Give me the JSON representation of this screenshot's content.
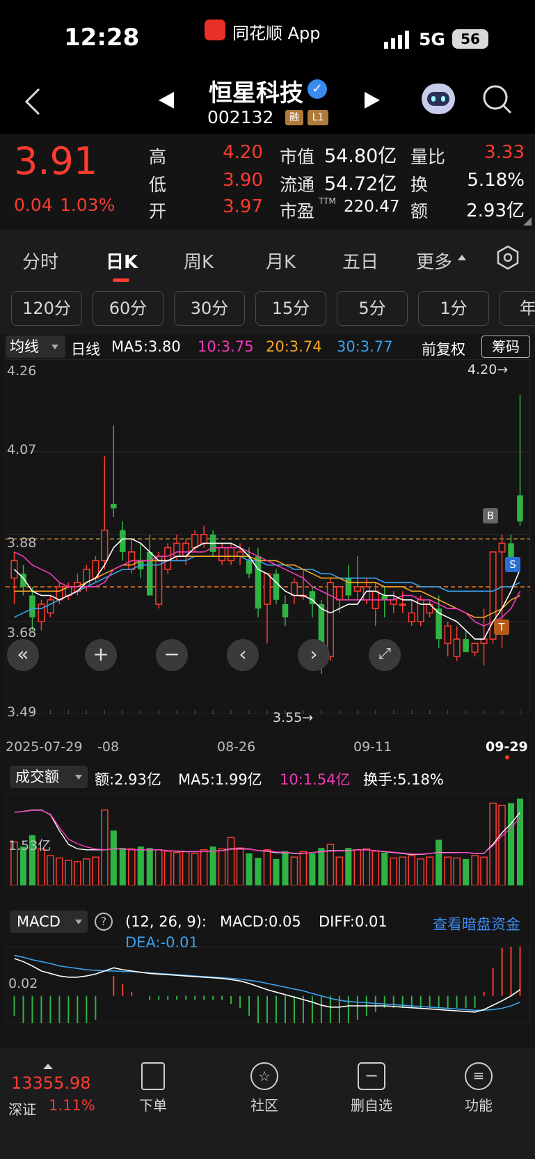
{
  "status_bar": {
    "time": "12:28",
    "app_label": "同花顺 App",
    "network": "5G",
    "battery": "56"
  },
  "header": {
    "stock_name": "恒星科技",
    "stock_code": "002132",
    "badge_margin": "融",
    "badge_level": "L1"
  },
  "quote": {
    "price": "3.91",
    "change": "0.04",
    "change_pct": "1.03%",
    "high_label": "高",
    "high": "4.20",
    "low_label": "低",
    "low": "3.90",
    "open_label": "开",
    "open": "3.97",
    "mcap_label": "市值",
    "mcap": "54.80亿",
    "float_label": "流通",
    "float": "54.72亿",
    "pe_label": "市盈",
    "pe_sup": "TTM",
    "pe": "220.47",
    "vr_label": "量比",
    "vr": "3.33",
    "turnover_label": "换",
    "turnover": "5.18%",
    "amount_label": "额",
    "amount": "2.93亿"
  },
  "tabs": [
    {
      "label": "分时"
    },
    {
      "label": "日K"
    },
    {
      "label": "周K"
    },
    {
      "label": "月K"
    },
    {
      "label": "五日"
    },
    {
      "label": "更多"
    }
  ],
  "periods": [
    {
      "label": "120分"
    },
    {
      "label": "60分"
    },
    {
      "label": "30分"
    },
    {
      "label": "15分"
    },
    {
      "label": "5分"
    },
    {
      "label": "1分"
    },
    {
      "label": "年"
    }
  ],
  "ma_bar": {
    "selector": "均线",
    "period": "日线",
    "ma5": "MA5:3.80",
    "ma10": "10:3.75",
    "ma20": "20:3.74",
    "ma30": "30:3.77",
    "adjust": "前复权",
    "chips": "筹码"
  },
  "kline": {
    "y_labels": [
      "4.26",
      "4.07",
      "3.88",
      "3.68",
      "3.49"
    ],
    "high_mark": "4.20→",
    "low_mark": "3.55→",
    "x_labels": [
      "2025-07-29",
      "-08",
      "08-26",
      "09-11",
      "09-29"
    ],
    "marker_b": "B",
    "marker_s": "S",
    "marker_t": "T"
  },
  "volume": {
    "selector": "成交额",
    "amount": "额:2.93亿",
    "ma5": "MA5:1.99亿",
    "ma10": "10:1.54亿",
    "turnover": "换手:5.18%",
    "y_label": "1.53亿"
  },
  "macd": {
    "selector": "MACD",
    "params": "(12, 26, 9):",
    "macd": "MACD:0.05",
    "diff": "DIFF:0.01",
    "dea": "DEA:-0.01",
    "dark_pool": "查看暗盘资金",
    "y_label": "0.02"
  },
  "bottom_nav": {
    "index_value": "13355.98",
    "index_name": "深证",
    "index_pct": "1.11%",
    "items": [
      {
        "label": "下单"
      },
      {
        "label": "社区"
      },
      {
        "label": "删自选"
      },
      {
        "label": "功能"
      }
    ]
  },
  "chart_data": {
    "type": "candlestick",
    "y_range": [
      3.49,
      4.26
    ],
    "candles": [
      {
        "o": 3.78,
        "h": 3.84,
        "l": 3.72,
        "c": 3.82
      },
      {
        "o": 3.79,
        "h": 3.81,
        "l": 3.74,
        "c": 3.76
      },
      {
        "o": 3.74,
        "h": 3.76,
        "l": 3.66,
        "c": 3.69
      },
      {
        "o": 3.68,
        "h": 3.73,
        "l": 3.66,
        "c": 3.72
      },
      {
        "o": 3.7,
        "h": 3.74,
        "l": 3.69,
        "c": 3.73
      },
      {
        "o": 3.73,
        "h": 3.77,
        "l": 3.72,
        "c": 3.76
      },
      {
        "o": 3.74,
        "h": 3.77,
        "l": 3.73,
        "c": 3.76
      },
      {
        "o": 3.75,
        "h": 3.79,
        "l": 3.74,
        "c": 3.77
      },
      {
        "o": 3.76,
        "h": 3.81,
        "l": 3.75,
        "c": 3.8
      },
      {
        "o": 3.78,
        "h": 3.83,
        "l": 3.77,
        "c": 3.82
      },
      {
        "o": 3.82,
        "h": 4.06,
        "l": 3.8,
        "c": 3.89
      },
      {
        "o": 3.95,
        "h": 4.13,
        "l": 3.92,
        "c": 3.94
      },
      {
        "o": 3.89,
        "h": 3.91,
        "l": 3.82,
        "c": 3.84
      },
      {
        "o": 3.8,
        "h": 3.87,
        "l": 3.79,
        "c": 3.84
      },
      {
        "o": 3.82,
        "h": 3.86,
        "l": 3.78,
        "c": 3.8
      },
      {
        "o": 3.84,
        "h": 3.88,
        "l": 3.74,
        "c": 3.74
      },
      {
        "o": 3.72,
        "h": 3.84,
        "l": 3.71,
        "c": 3.83
      },
      {
        "o": 3.8,
        "h": 3.86,
        "l": 3.79,
        "c": 3.85
      },
      {
        "o": 3.83,
        "h": 3.88,
        "l": 3.82,
        "c": 3.86
      },
      {
        "o": 3.83,
        "h": 3.87,
        "l": 3.81,
        "c": 3.86
      },
      {
        "o": 3.85,
        "h": 3.89,
        "l": 3.84,
        "c": 3.88
      },
      {
        "o": 3.86,
        "h": 3.9,
        "l": 3.85,
        "c": 3.88
      },
      {
        "o": 3.88,
        "h": 3.89,
        "l": 3.83,
        "c": 3.84
      },
      {
        "o": 3.82,
        "h": 3.86,
        "l": 3.81,
        "c": 3.85
      },
      {
        "o": 3.82,
        "h": 3.86,
        "l": 3.81,
        "c": 3.85
      },
      {
        "o": 3.83,
        "h": 3.86,
        "l": 3.81,
        "c": 3.84
      },
      {
        "o": 3.82,
        "h": 3.85,
        "l": 3.78,
        "c": 3.79
      },
      {
        "o": 3.83,
        "h": 3.85,
        "l": 3.69,
        "c": 3.71
      },
      {
        "o": 3.72,
        "h": 3.79,
        "l": 3.63,
        "c": 3.79
      },
      {
        "o": 3.79,
        "h": 3.8,
        "l": 3.72,
        "c": 3.73
      },
      {
        "o": 3.72,
        "h": 3.74,
        "l": 3.67,
        "c": 3.69
      },
      {
        "o": 3.74,
        "h": 3.78,
        "l": 3.72,
        "c": 3.77
      },
      {
        "o": 3.74,
        "h": 3.8,
        "l": 3.73,
        "c": 3.74
      },
      {
        "o": 3.75,
        "h": 3.76,
        "l": 3.69,
        "c": 3.72
      },
      {
        "o": 3.72,
        "h": 3.73,
        "l": 3.56,
        "c": 3.59
      },
      {
        "o": 3.6,
        "h": 3.78,
        "l": 3.59,
        "c": 3.77
      },
      {
        "o": 3.73,
        "h": 3.76,
        "l": 3.7,
        "c": 3.76
      },
      {
        "o": 3.78,
        "h": 3.81,
        "l": 3.73,
        "c": 3.74
      },
      {
        "o": 3.75,
        "h": 3.83,
        "l": 3.73,
        "c": 3.76
      },
      {
        "o": 3.73,
        "h": 3.78,
        "l": 3.72,
        "c": 3.76
      },
      {
        "o": 3.71,
        "h": 3.77,
        "l": 3.67,
        "c": 3.75
      },
      {
        "o": 3.74,
        "h": 3.76,
        "l": 3.69,
        "c": 3.73
      },
      {
        "o": 3.72,
        "h": 3.75,
        "l": 3.7,
        "c": 3.73
      },
      {
        "o": 3.72,
        "h": 3.75,
        "l": 3.7,
        "c": 3.72
      },
      {
        "o": 3.68,
        "h": 3.73,
        "l": 3.67,
        "c": 3.7
      },
      {
        "o": 3.68,
        "h": 3.74,
        "l": 3.67,
        "c": 3.73
      },
      {
        "o": 3.7,
        "h": 3.73,
        "l": 3.69,
        "c": 3.72
      },
      {
        "o": 3.71,
        "h": 3.74,
        "l": 3.62,
        "c": 3.64
      },
      {
        "o": 3.63,
        "h": 3.68,
        "l": 3.6,
        "c": 3.67
      },
      {
        "o": 3.6,
        "h": 3.67,
        "l": 3.59,
        "c": 3.64
      },
      {
        "o": 3.64,
        "h": 3.66,
        "l": 3.62,
        "c": 3.61
      },
      {
        "o": 3.61,
        "h": 3.63,
        "l": 3.6,
        "c": 3.63
      },
      {
        "o": 3.63,
        "h": 3.71,
        "l": 3.58,
        "c": 3.64
      },
      {
        "o": 3.64,
        "h": 3.76,
        "l": 3.63,
        "c": 3.84
      },
      {
        "o": 3.84,
        "h": 3.88,
        "l": 3.62,
        "c": 3.86
      },
      {
        "o": 3.86,
        "h": 3.88,
        "l": 3.8,
        "c": 3.82
      },
      {
        "o": 3.97,
        "h": 4.2,
        "l": 3.9,
        "c": 3.91
      }
    ],
    "ma5": [
      3.8,
      3.78,
      3.75,
      3.74,
      3.74,
      3.73,
      3.74,
      3.75,
      3.77,
      3.78,
      3.81,
      3.85,
      3.87,
      3.87,
      3.86,
      3.84,
      3.82,
      3.82,
      3.83,
      3.83,
      3.85,
      3.86,
      3.86,
      3.86,
      3.86,
      3.85,
      3.83,
      3.8,
      3.79,
      3.77,
      3.75,
      3.74,
      3.74,
      3.73,
      3.71,
      3.7,
      3.71,
      3.72,
      3.72,
      3.75,
      3.75,
      3.74,
      3.74,
      3.73,
      3.73,
      3.72,
      3.72,
      3.7,
      3.69,
      3.68,
      3.66,
      3.64,
      3.64,
      3.68,
      3.71,
      3.75,
      3.8
    ],
    "ma10": [
      3.84,
      3.83,
      3.81,
      3.8,
      3.79,
      3.77,
      3.76,
      3.76,
      3.76,
      3.76,
      3.77,
      3.8,
      3.81,
      3.82,
      3.82,
      3.82,
      3.83,
      3.83,
      3.84,
      3.84,
      3.84,
      3.84,
      3.85,
      3.85,
      3.85,
      3.85,
      3.84,
      3.83,
      3.82,
      3.81,
      3.8,
      3.79,
      3.78,
      3.76,
      3.75,
      3.74,
      3.73,
      3.73,
      3.73,
      3.73,
      3.73,
      3.73,
      3.73,
      3.74,
      3.74,
      3.73,
      3.73,
      3.72,
      3.71,
      3.71,
      3.7,
      3.68,
      3.67,
      3.68,
      3.69,
      3.71,
      3.75
    ],
    "ma20": [
      3.75,
      3.75,
      3.75,
      3.75,
      3.75,
      3.75,
      3.76,
      3.76,
      3.77,
      3.78,
      3.79,
      3.8,
      3.81,
      3.81,
      3.82,
      3.82,
      3.82,
      3.82,
      3.83,
      3.83,
      3.83,
      3.83,
      3.83,
      3.83,
      3.83,
      3.83,
      3.83,
      3.82,
      3.82,
      3.82,
      3.81,
      3.81,
      3.8,
      3.79,
      3.78,
      3.78,
      3.78,
      3.77,
      3.77,
      3.77,
      3.77,
      3.76,
      3.76,
      3.76,
      3.75,
      3.75,
      3.74,
      3.73,
      3.72,
      3.71,
      3.7,
      3.69,
      3.69,
      3.7,
      3.71,
      3.73,
      3.74
    ],
    "ma30": [
      3.69,
      3.7,
      3.71,
      3.71,
      3.72,
      3.73,
      3.74,
      3.75,
      3.76,
      3.77,
      3.78,
      3.79,
      3.8,
      3.8,
      3.81,
      3.81,
      3.81,
      3.82,
      3.82,
      3.82,
      3.83,
      3.83,
      3.83,
      3.83,
      3.83,
      3.83,
      3.82,
      3.82,
      3.81,
      3.81,
      3.81,
      3.8,
      3.8,
      3.8,
      3.79,
      3.79,
      3.78,
      3.78,
      3.78,
      3.78,
      3.78,
      3.77,
      3.77,
      3.77,
      3.77,
      3.76,
      3.76,
      3.76,
      3.75,
      3.75,
      3.75,
      3.75,
      3.75,
      3.75,
      3.76,
      3.76,
      3.77
    ],
    "volume": [
      0.95,
      0.85,
      1.1,
      0.8,
      0.65,
      0.6,
      0.55,
      0.52,
      0.58,
      0.62,
      1.65,
      1.2,
      0.82,
      0.8,
      0.85,
      0.82,
      0.78,
      0.75,
      0.72,
      0.74,
      0.7,
      0.78,
      0.85,
      0.8,
      1.05,
      0.82,
      0.7,
      0.6,
      0.78,
      0.58,
      0.75,
      0.62,
      0.74,
      0.7,
      0.82,
      0.9,
      0.62,
      0.82,
      0.78,
      0.8,
      0.75,
      0.72,
      0.6,
      0.62,
      0.65,
      0.58,
      0.62,
      1.0,
      0.62,
      0.6,
      0.58,
      0.65,
      0.62,
      1.8,
      1.75,
      1.8,
      1.9
    ],
    "vol_ma5": [
      1.6,
      1.62,
      1.65,
      1.65,
      1.55,
      1.2,
      0.9,
      0.8,
      0.78,
      0.78,
      0.78,
      0.8,
      0.8,
      0.78,
      0.78,
      0.78,
      0.78,
      0.76,
      0.75,
      0.74,
      0.74,
      0.74,
      0.75,
      0.76,
      0.8,
      0.8,
      0.8,
      0.76,
      0.75,
      0.72,
      0.72,
      0.7,
      0.7,
      0.72,
      0.74,
      0.76,
      0.76,
      0.76,
      0.78,
      0.78,
      0.76,
      0.74,
      0.72,
      0.7,
      0.68,
      0.68,
      0.7,
      0.72,
      0.72,
      0.72,
      0.72,
      0.7,
      0.7,
      0.9,
      1.15,
      1.35,
      1.6
    ],
    "macd_diff": [
      0.06,
      0.055,
      0.048,
      0.04,
      0.036,
      0.032,
      0.03,
      0.03,
      0.032,
      0.035,
      0.04,
      0.045,
      0.042,
      0.04,
      0.038,
      0.036,
      0.035,
      0.034,
      0.033,
      0.032,
      0.031,
      0.03,
      0.029,
      0.028,
      0.026,
      0.024,
      0.02,
      0.015,
      0.01,
      0.006,
      0.002,
      -0.002,
      -0.006,
      -0.01,
      -0.015,
      -0.018,
      -0.018,
      -0.016,
      -0.016,
      -0.016,
      -0.016,
      -0.016,
      -0.017,
      -0.018,
      -0.019,
      -0.02,
      -0.021,
      -0.022,
      -0.023,
      -0.024,
      -0.025,
      -0.026,
      -0.022,
      -0.015,
      -0.008,
      0.0,
      0.01
    ],
    "macd_dea": [
      0.065,
      0.062,
      0.058,
      0.055,
      0.052,
      0.048,
      0.046,
      0.044,
      0.042,
      0.041,
      0.04,
      0.04,
      0.039,
      0.039,
      0.038,
      0.037,
      0.036,
      0.035,
      0.034,
      0.033,
      0.032,
      0.031,
      0.03,
      0.029,
      0.028,
      0.027,
      0.025,
      0.023,
      0.02,
      0.017,
      0.014,
      0.011,
      0.008,
      0.004,
      0.0,
      -0.004,
      -0.007,
      -0.009,
      -0.01,
      -0.011,
      -0.012,
      -0.013,
      -0.014,
      -0.015,
      -0.016,
      -0.017,
      -0.018,
      -0.019,
      -0.02,
      -0.021,
      -0.022,
      -0.023,
      -0.023,
      -0.022,
      -0.02,
      -0.016,
      -0.01
    ]
  }
}
